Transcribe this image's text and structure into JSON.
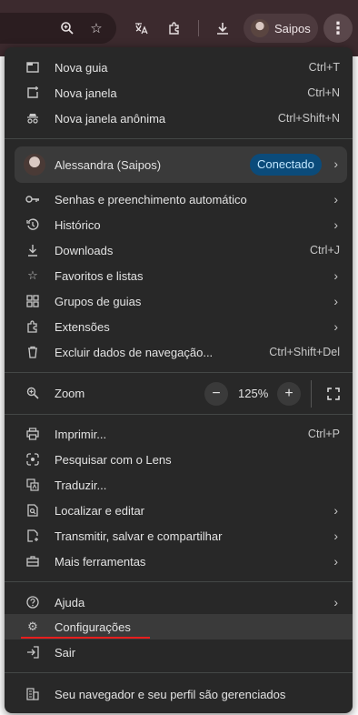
{
  "toolbar": {
    "profile_label": "Saipos",
    "icons": [
      "zoom-icon",
      "bookmark-star-icon",
      "translate-icon",
      "extensions-icon",
      "download-icon",
      "menu-kebab-icon"
    ]
  },
  "menu": {
    "group1": [
      {
        "label": "Nova guia",
        "shortcut": "Ctrl+T",
        "icon": "new-tab-icon"
      },
      {
        "label": "Nova janela",
        "shortcut": "Ctrl+N",
        "icon": "new-window-icon"
      },
      {
        "label": "Nova janela anônima",
        "shortcut": "Ctrl+Shift+N",
        "icon": "incognito-icon"
      }
    ],
    "profile": {
      "name": "Alessandra (Saipos)",
      "badge": "Conectado"
    },
    "group2": [
      {
        "label": "Senhas e preenchimento automático",
        "icon": "key-icon"
      },
      {
        "label": "Histórico",
        "icon": "history-icon"
      },
      {
        "label": "Downloads",
        "shortcut": "Ctrl+J",
        "icon": "download-icon"
      },
      {
        "label": "Favoritos e listas",
        "icon": "star-icon"
      },
      {
        "label": "Grupos de guias",
        "icon": "tab-groups-icon"
      },
      {
        "label": "Extensões",
        "icon": "extensions-icon"
      },
      {
        "label": "Excluir dados de navegação...",
        "shortcut": "Ctrl+Shift+Del",
        "icon": "trash-icon"
      }
    ],
    "zoom": {
      "label": "Zoom",
      "value": "125%",
      "minus": "−",
      "plus": "+"
    },
    "group3": [
      {
        "label": "Imprimir...",
        "shortcut": "Ctrl+P",
        "icon": "print-icon"
      },
      {
        "label": "Pesquisar com o Lens",
        "icon": "lens-icon"
      },
      {
        "label": "Traduzir...",
        "icon": "translate-icon"
      },
      {
        "label": "Localizar e editar",
        "icon": "find-icon"
      },
      {
        "label": "Transmitir, salvar e compartilhar",
        "icon": "cast-icon"
      },
      {
        "label": "Mais ferramentas",
        "icon": "toolbox-icon"
      }
    ],
    "group4": [
      {
        "label": "Ajuda",
        "icon": "help-icon"
      },
      {
        "label": "Configurações",
        "icon": "gear-icon"
      },
      {
        "label": "Sair",
        "icon": "exit-icon"
      }
    ],
    "managed": {
      "label": "Seu navegador e seu perfil são gerenciados",
      "icon": "building-icon"
    }
  },
  "colors": {
    "menu_bg": "#282828",
    "badge_bg": "#0b4b7a",
    "underline": "#e81d1d"
  }
}
